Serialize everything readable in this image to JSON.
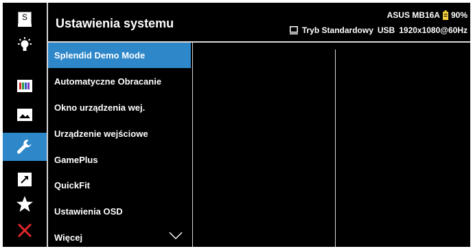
{
  "header": {
    "title": "Ustawienia systemu",
    "model": "ASUS MB16A",
    "battery": "90%",
    "mode": "Tryb Standardowy",
    "input": "USB",
    "resolution": "1920x1080@60Hz"
  },
  "sidebar_icons": [
    {
      "name": "splendid-icon",
      "label": "S"
    },
    {
      "name": "blue-light-filter-icon"
    },
    {
      "name": "color-icon"
    },
    {
      "name": "image-icon"
    },
    {
      "name": "system-setup-icon",
      "selected": true
    },
    {
      "name": "shortcut-icon"
    },
    {
      "name": "my-favorite-icon"
    },
    {
      "name": "exit-icon"
    }
  ],
  "menu": {
    "items": [
      {
        "label": "Splendid Demo Mode",
        "selected": true
      },
      {
        "label": "Automatyczne Obracanie"
      },
      {
        "label": "Okno urządzenia wej."
      },
      {
        "label": "Urządzenie wejściowe"
      },
      {
        "label": "GamePlus"
      },
      {
        "label": "QuickFit"
      },
      {
        "label": "Ustawienia OSD"
      },
      {
        "label": "Więcej"
      }
    ]
  },
  "colors": {
    "accent": "#2d87c9",
    "background": "#000000",
    "text": "#ffffff",
    "battery": "#f4d03f",
    "exit": "#e3262b"
  }
}
